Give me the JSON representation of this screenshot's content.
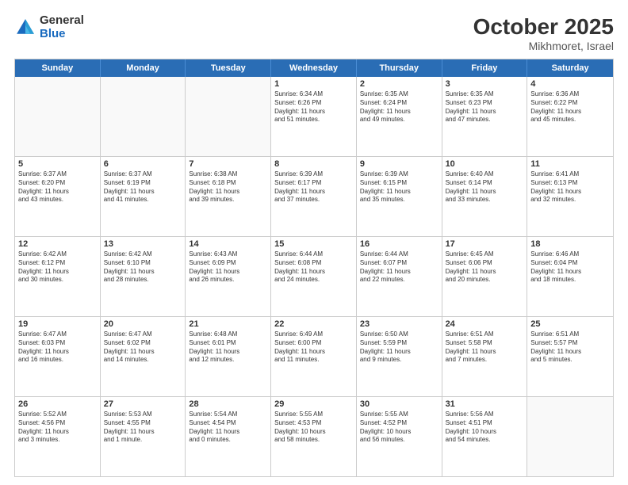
{
  "logo": {
    "general": "General",
    "blue": "Blue"
  },
  "title": "October 2025",
  "subtitle": "Mikhmoret, Israel",
  "days": [
    "Sunday",
    "Monday",
    "Tuesday",
    "Wednesday",
    "Thursday",
    "Friday",
    "Saturday"
  ],
  "weeks": [
    [
      {
        "day": "",
        "text": ""
      },
      {
        "day": "",
        "text": ""
      },
      {
        "day": "",
        "text": ""
      },
      {
        "day": "1",
        "text": "Sunrise: 6:34 AM\nSunset: 6:26 PM\nDaylight: 11 hours\nand 51 minutes."
      },
      {
        "day": "2",
        "text": "Sunrise: 6:35 AM\nSunset: 6:24 PM\nDaylight: 11 hours\nand 49 minutes."
      },
      {
        "day": "3",
        "text": "Sunrise: 6:35 AM\nSunset: 6:23 PM\nDaylight: 11 hours\nand 47 minutes."
      },
      {
        "day": "4",
        "text": "Sunrise: 6:36 AM\nSunset: 6:22 PM\nDaylight: 11 hours\nand 45 minutes."
      }
    ],
    [
      {
        "day": "5",
        "text": "Sunrise: 6:37 AM\nSunset: 6:20 PM\nDaylight: 11 hours\nand 43 minutes."
      },
      {
        "day": "6",
        "text": "Sunrise: 6:37 AM\nSunset: 6:19 PM\nDaylight: 11 hours\nand 41 minutes."
      },
      {
        "day": "7",
        "text": "Sunrise: 6:38 AM\nSunset: 6:18 PM\nDaylight: 11 hours\nand 39 minutes."
      },
      {
        "day": "8",
        "text": "Sunrise: 6:39 AM\nSunset: 6:17 PM\nDaylight: 11 hours\nand 37 minutes."
      },
      {
        "day": "9",
        "text": "Sunrise: 6:39 AM\nSunset: 6:15 PM\nDaylight: 11 hours\nand 35 minutes."
      },
      {
        "day": "10",
        "text": "Sunrise: 6:40 AM\nSunset: 6:14 PM\nDaylight: 11 hours\nand 33 minutes."
      },
      {
        "day": "11",
        "text": "Sunrise: 6:41 AM\nSunset: 6:13 PM\nDaylight: 11 hours\nand 32 minutes."
      }
    ],
    [
      {
        "day": "12",
        "text": "Sunrise: 6:42 AM\nSunset: 6:12 PM\nDaylight: 11 hours\nand 30 minutes."
      },
      {
        "day": "13",
        "text": "Sunrise: 6:42 AM\nSunset: 6:10 PM\nDaylight: 11 hours\nand 28 minutes."
      },
      {
        "day": "14",
        "text": "Sunrise: 6:43 AM\nSunset: 6:09 PM\nDaylight: 11 hours\nand 26 minutes."
      },
      {
        "day": "15",
        "text": "Sunrise: 6:44 AM\nSunset: 6:08 PM\nDaylight: 11 hours\nand 24 minutes."
      },
      {
        "day": "16",
        "text": "Sunrise: 6:44 AM\nSunset: 6:07 PM\nDaylight: 11 hours\nand 22 minutes."
      },
      {
        "day": "17",
        "text": "Sunrise: 6:45 AM\nSunset: 6:06 PM\nDaylight: 11 hours\nand 20 minutes."
      },
      {
        "day": "18",
        "text": "Sunrise: 6:46 AM\nSunset: 6:04 PM\nDaylight: 11 hours\nand 18 minutes."
      }
    ],
    [
      {
        "day": "19",
        "text": "Sunrise: 6:47 AM\nSunset: 6:03 PM\nDaylight: 11 hours\nand 16 minutes."
      },
      {
        "day": "20",
        "text": "Sunrise: 6:47 AM\nSunset: 6:02 PM\nDaylight: 11 hours\nand 14 minutes."
      },
      {
        "day": "21",
        "text": "Sunrise: 6:48 AM\nSunset: 6:01 PM\nDaylight: 11 hours\nand 12 minutes."
      },
      {
        "day": "22",
        "text": "Sunrise: 6:49 AM\nSunset: 6:00 PM\nDaylight: 11 hours\nand 11 minutes."
      },
      {
        "day": "23",
        "text": "Sunrise: 6:50 AM\nSunset: 5:59 PM\nDaylight: 11 hours\nand 9 minutes."
      },
      {
        "day": "24",
        "text": "Sunrise: 6:51 AM\nSunset: 5:58 PM\nDaylight: 11 hours\nand 7 minutes."
      },
      {
        "day": "25",
        "text": "Sunrise: 6:51 AM\nSunset: 5:57 PM\nDaylight: 11 hours\nand 5 minutes."
      }
    ],
    [
      {
        "day": "26",
        "text": "Sunrise: 5:52 AM\nSunset: 4:56 PM\nDaylight: 11 hours\nand 3 minutes."
      },
      {
        "day": "27",
        "text": "Sunrise: 5:53 AM\nSunset: 4:55 PM\nDaylight: 11 hours\nand 1 minute."
      },
      {
        "day": "28",
        "text": "Sunrise: 5:54 AM\nSunset: 4:54 PM\nDaylight: 11 hours\nand 0 minutes."
      },
      {
        "day": "29",
        "text": "Sunrise: 5:55 AM\nSunset: 4:53 PM\nDaylight: 10 hours\nand 58 minutes."
      },
      {
        "day": "30",
        "text": "Sunrise: 5:55 AM\nSunset: 4:52 PM\nDaylight: 10 hours\nand 56 minutes."
      },
      {
        "day": "31",
        "text": "Sunrise: 5:56 AM\nSunset: 4:51 PM\nDaylight: 10 hours\nand 54 minutes."
      },
      {
        "day": "",
        "text": ""
      }
    ]
  ]
}
